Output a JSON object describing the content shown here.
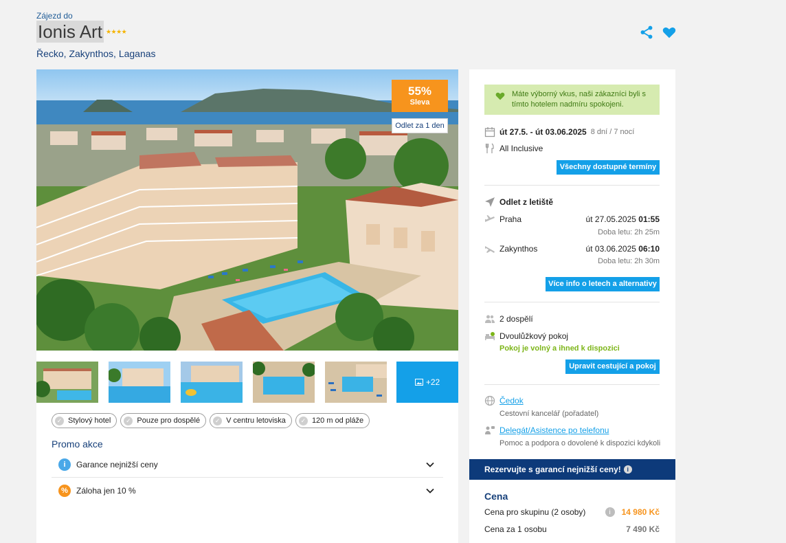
{
  "header": {
    "kicker": "Zájezd do",
    "title": "Ionis Art",
    "stars": "★★★★",
    "location": "Řecko, Zakynthos, Laganas"
  },
  "hero": {
    "discount_pct": "55%",
    "discount_label": "Sleva",
    "departure_badge": "Odlet za 1 den"
  },
  "thumbnails": {
    "more_label": "+22"
  },
  "tags": [
    "Stylový hotel",
    "Pouze pro dospělé",
    "V centru letoviska",
    "120 m od pláže"
  ],
  "promo": {
    "title": "Promo akce",
    "items": [
      {
        "label": "Garance nejnižší ceny",
        "icon": "info-icon",
        "color": "#4aa8e8"
      },
      {
        "label": "Záloha jen 10 %",
        "icon": "percent-icon",
        "color": "#f7941d"
      }
    ]
  },
  "sidebar": {
    "note": "Máte výborný vkus, naši zákazníci byli s tímto hotelem nadmíru spokojeni.",
    "dates": "út 27.5. - út 03.06.2025",
    "duration": "8 dní / 7 nocí",
    "board": "All Inclusive",
    "all_dates_button": "Všechny dostupné termíny",
    "flights_title": "Odlet z letiště",
    "outbound": {
      "from": "Praha",
      "date": "út 27.05.2025",
      "time": "01:55",
      "duration": "Doba letu: 2h 25m"
    },
    "inbound": {
      "from": "Zakynthos",
      "date": "út 03.06.2025",
      "time": "06:10",
      "duration": "Doba letu: 2h 30m"
    },
    "flights_button": "Více info o letech a alternativy",
    "travelers": "2 dospělí",
    "room": "Dvoulůžkový pokoj",
    "room_status": "Pokoj je volný a ihned k dispozici",
    "edit_button": "Upravit cestující a pokoj",
    "operator": "Čedok",
    "operator_desc": "Cestovní kancelář (pořadatel)",
    "support": "Delegát/Asistence po telefonu",
    "support_desc": "Pomoc a podpora o dovolené k dispozici kdykoli"
  },
  "reserve": {
    "text": "Rezervujte s garancí nejnižší ceny!"
  },
  "price": {
    "title": "Cena",
    "group_label": "Cena pro skupinu (2 osoby)",
    "group_value": "14 980 Kč",
    "person_label": "Cena za 1 osobu",
    "person_value": "7 490 Kč"
  },
  "colors": {
    "accent": "#14a0e8",
    "navy": "#17407a",
    "orange": "#f7941d",
    "green": "#7cb518"
  }
}
